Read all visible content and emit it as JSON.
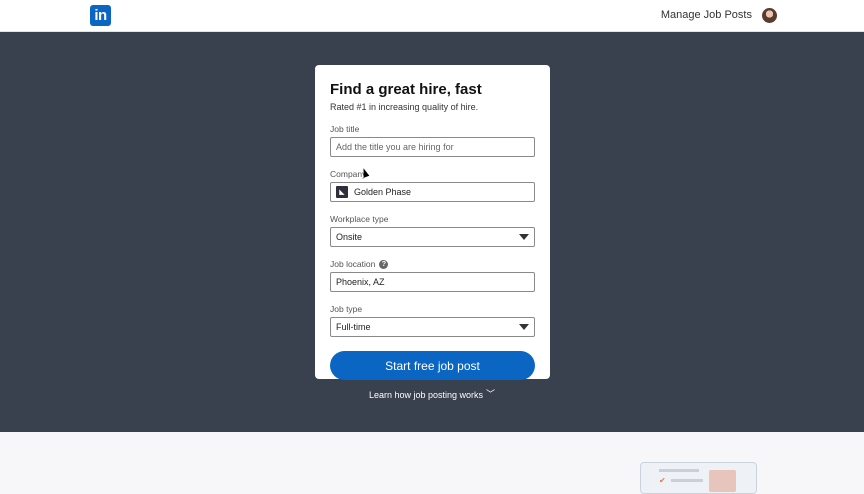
{
  "header": {
    "logo_text": "in",
    "manage_label": "Manage Job Posts"
  },
  "card": {
    "title": "Find a great hire, fast",
    "subtitle": "Rated #1 in increasing quality of hire.",
    "job_title": {
      "label": "Job title",
      "placeholder": "Add the title you are hiring for"
    },
    "company": {
      "label": "Company",
      "value": "Golden Phase"
    },
    "workplace": {
      "label": "Workplace type",
      "value": "Onsite"
    },
    "location": {
      "label": "Job location",
      "value": "Phoenix, AZ"
    },
    "job_type": {
      "label": "Job type",
      "value": "Full-time"
    },
    "cta_label": "Start free job post"
  },
  "learn_more": "Learn how job posting works",
  "colors": {
    "brand": "#0a66c2",
    "hero_bg": "#39414e"
  }
}
